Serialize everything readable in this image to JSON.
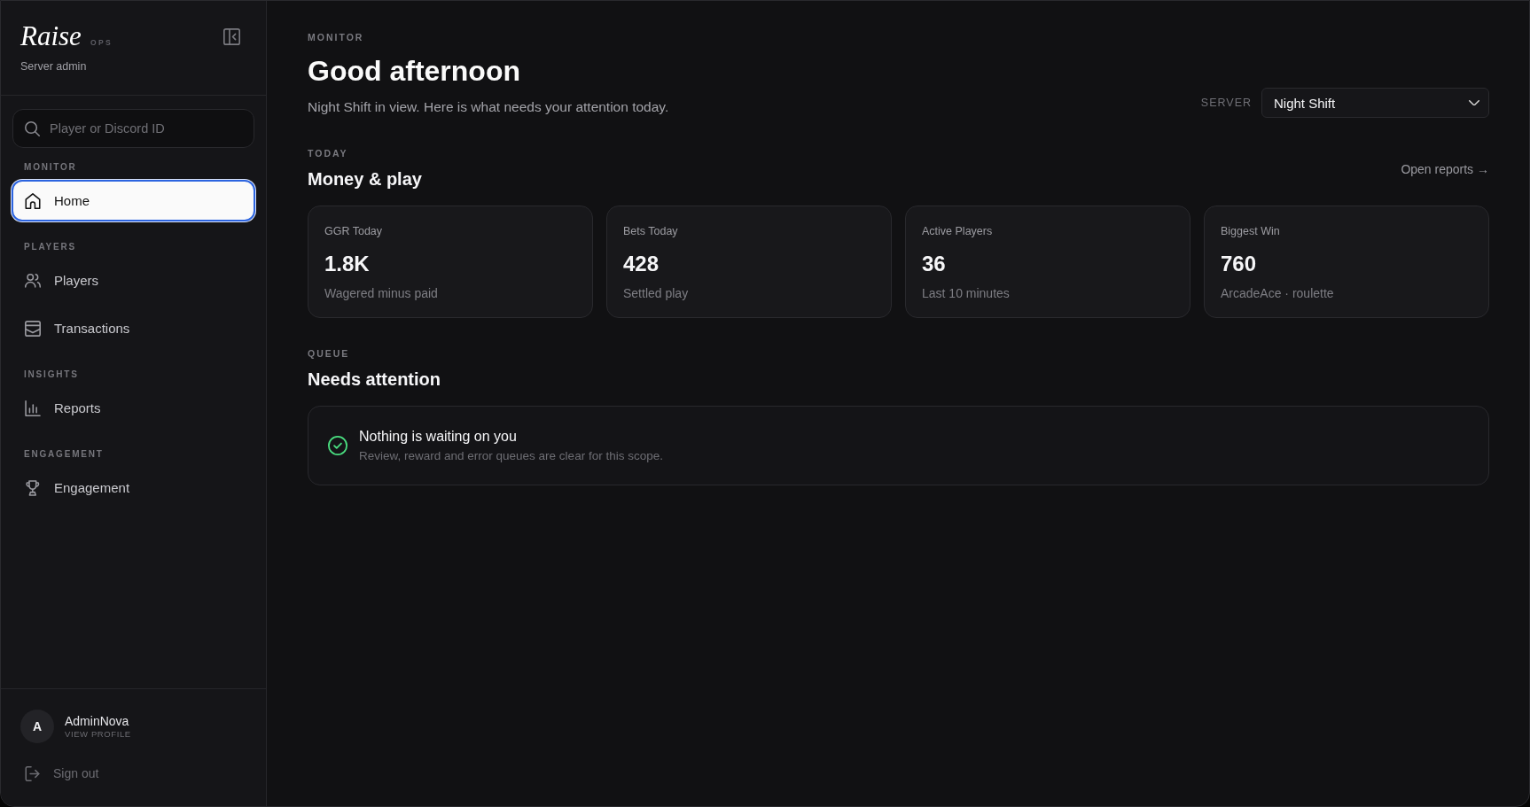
{
  "sidebar": {
    "logo": "Raise",
    "logo_tag": "OPS",
    "subtitle": "Server admin",
    "search": {
      "placeholder": "Player or Discord ID"
    },
    "sections": [
      {
        "heading": "MONITOR",
        "items": [
          {
            "label": "Home",
            "selected": true
          }
        ]
      },
      {
        "heading": "PLAYERS",
        "items": [
          {
            "label": "Players",
            "selected": false
          },
          {
            "label": "Transactions",
            "selected": false
          }
        ]
      },
      {
        "heading": "INSIGHTS",
        "items": [
          {
            "label": "Reports",
            "selected": false
          }
        ]
      },
      {
        "heading": "ENGAGEMENT",
        "items": [
          {
            "label": "Engagement",
            "selected": false
          }
        ]
      }
    ],
    "user": {
      "initial": "A",
      "name": "AdminNova",
      "link": "VIEW PROFILE"
    },
    "sign_out": "Sign out"
  },
  "header": {
    "eyebrow": "MONITOR",
    "title": "Good afternoon",
    "subtitle": "Night Shift in view. Here is what needs your attention today.",
    "server": {
      "label": "SERVER",
      "value": "Night Shift"
    }
  },
  "today": {
    "eyebrow": "TODAY",
    "title": "Money & play",
    "link": "Open reports →",
    "stats": [
      {
        "label": "GGR Today",
        "value": "1.8K",
        "caption": "Wagered minus paid"
      },
      {
        "label": "Bets Today",
        "value": "428",
        "caption": "Settled play"
      },
      {
        "label": "Active Players",
        "value": "36",
        "caption": "Last 10 minutes"
      },
      {
        "label": "Biggest Win",
        "value": "760",
        "caption": "ArcadeAce · roulette"
      }
    ]
  },
  "queue": {
    "eyebrow": "QUEUE",
    "title": "Needs attention",
    "empty_state": {
      "title": "Nothing is waiting on you",
      "description": "Review, reward and error queues are clear for this scope."
    }
  }
}
